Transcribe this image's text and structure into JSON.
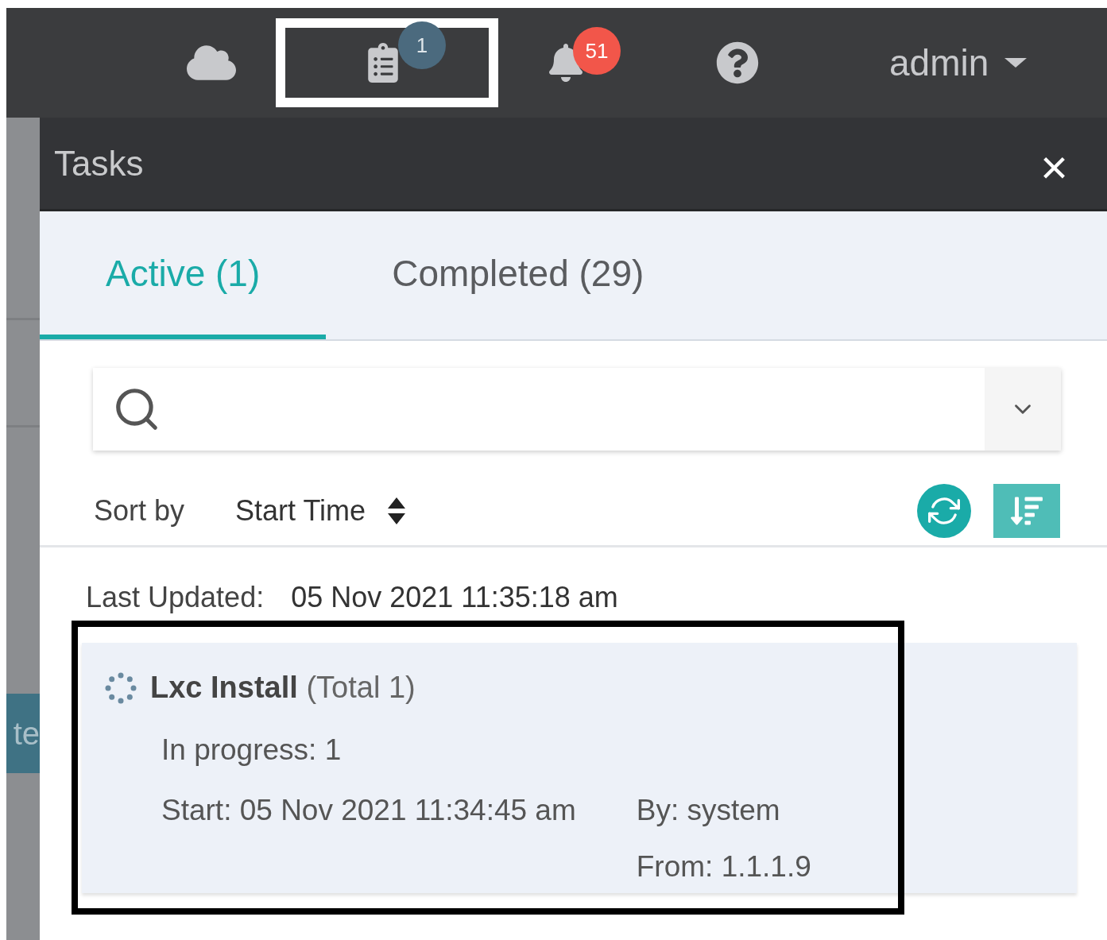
{
  "top_bar": {
    "tasks_badge": "1",
    "alerts_badge": "51",
    "user": "admin",
    "tasks_highlighted": true
  },
  "side_strip": {
    "item_text": "te"
  },
  "panel": {
    "title": "Tasks",
    "close": "×"
  },
  "tabs": [
    {
      "label": "Active (1)",
      "selected": true
    },
    {
      "label": "Completed (29)",
      "selected": false
    }
  ],
  "sort": {
    "label": "Sort by",
    "field": "Start Time"
  },
  "last_updated": {
    "label": "Last Updated:",
    "value": "05 Nov 2021 11:35:18 am"
  },
  "tasks": [
    {
      "name": "Lxc Install",
      "total": "(Total 1)",
      "status": "In progress: 1",
      "start": "Start: 05 Nov 2021 11:34:45 am",
      "by": "By: system",
      "from": "From: 1.1.1.9",
      "highlighted": true
    }
  ]
}
